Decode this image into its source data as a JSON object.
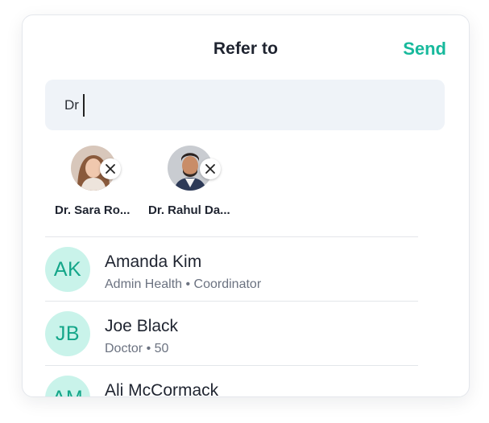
{
  "header": {
    "title": "Refer to",
    "send_label": "Send"
  },
  "search": {
    "value": "Dr"
  },
  "selected": [
    {
      "name": "Dr. Sara Ro..."
    },
    {
      "name": "Dr. Rahul Da..."
    }
  ],
  "contacts": [
    {
      "initials": "AK",
      "name": "Amanda Kim",
      "subtitle": "Admin Health • Coordinator"
    },
    {
      "initials": "JB",
      "name": "Joe Black",
      "subtitle": "Doctor • 50"
    },
    {
      "initials": "AM",
      "name": "Ali McCormack",
      "subtitle": ""
    }
  ],
  "colors": {
    "accent": "#17b99c",
    "avatar_bg": "#c9f3ea",
    "avatar_text": "#14a689"
  },
  "icons": {
    "remove": "close-icon"
  }
}
